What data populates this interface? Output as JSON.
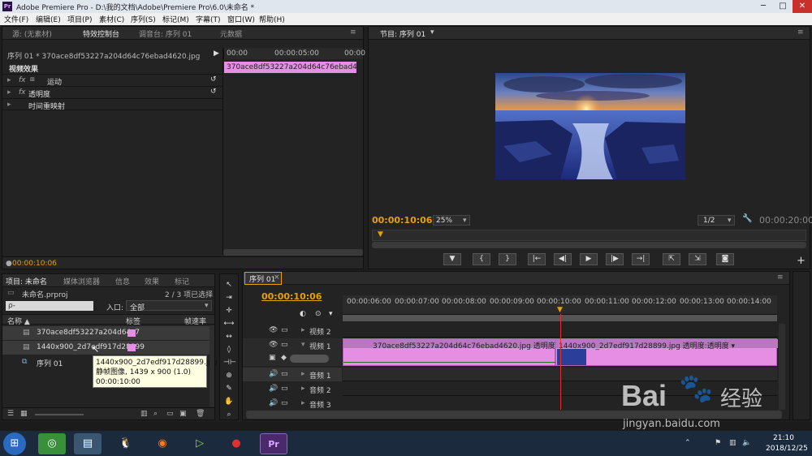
{
  "window": {
    "logo": "Pr",
    "title": "Adobe Premiere Pro - D:\\我的文档\\Adobe\\Premiere Pro\\6.0\\未命名 *",
    "controls": [
      "─",
      "□",
      "✕"
    ]
  },
  "menu": [
    "文件(F)",
    "编辑(E)",
    "项目(P)",
    "素材(C)",
    "序列(S)",
    "标记(M)",
    "字幕(T)",
    "窗口(W)",
    "帮助(H)"
  ],
  "effects_panel": {
    "tabs": [
      "源: (无素材)",
      "特效控制台",
      "调音台: 序列 01",
      "元数据"
    ],
    "menu_glyph": "≡",
    "clip_path": "序列 01 * 370ace8df53227a204d64c76ebad4620.jpg",
    "ruler": [
      "00:00",
      "00:00:05:00",
      "00:00"
    ],
    "clip_bar": "370ace8df53227a204d64c76ebad4620.jpg",
    "section": "视频效果",
    "fx_rows": [
      {
        "fx": "fx",
        "label": "运动",
        "reset": "↺"
      },
      {
        "fx": "fx",
        "label": "透明度",
        "reset": "↺"
      },
      {
        "fx": "",
        "label": "时间重映射",
        "reset": ""
      }
    ],
    "timecode": "00:00:10:06"
  },
  "program": {
    "tab": "节目: 序列 01",
    "timecode": "00:00:10:06",
    "zoom": "25%",
    "resolution": "1/2",
    "duration": "00:00:20:00",
    "buttons": [
      "▼",
      "{",
      "}",
      "|←",
      "◀|",
      "▶",
      "|▶",
      "→|",
      "⇱",
      "⇲",
      "◙"
    ]
  },
  "project": {
    "tabs": [
      "项目: 未命名",
      "媒体浏览器",
      "信息",
      "效果",
      "标记"
    ],
    "filename": "未命名.prproj",
    "count": "2 / 3 项已选择",
    "search_placeholder": "ρ-",
    "entry_label": "入口:",
    "entry_value": "全部",
    "col_name": "名称 ▲",
    "col_label": "标签",
    "col_rate": "帧速率",
    "items": [
      {
        "name": "370ace8df53227a204d64c7",
        "color": "#e58ee3"
      },
      {
        "name": "1440x900_2d7edf917d28899",
        "color": "#e58ee3"
      },
      {
        "name": "序列 01",
        "color": ""
      }
    ],
    "tooltip": [
      "1440x900_2d7edf917d28899.jpg",
      "静帧图像, 1439 x 900 (1.0)",
      "00:00:10:00"
    ]
  },
  "timeline": {
    "tab": "序列 01",
    "timecode": "00:00:10:06",
    "ruler": [
      "00:00:06:00",
      "00:00:07:00",
      "00:00:08:00",
      "00:00:09:00",
      "00:00:10:00",
      "00:00:11:00",
      "00:00:12:00",
      "00:00:13:00",
      "00:00:14:00"
    ],
    "tracks": [
      "视频 2",
      "视频 1",
      "音频 1",
      "音频 2",
      "音频 3"
    ],
    "clip1": "370ace8df53227a204d64c76ebad4620.jpg  透明度:透明度 ▾",
    "clip2": "1440x900_2d7edf917d28899.jpg  透明度:透明度 ▾"
  },
  "taskbar": {
    "time": "21:10",
    "date": "2018/12/25",
    "premiere": "Pr"
  },
  "watermark": {
    "brand": "Bai",
    "brand_cn": "经验",
    "url": "jingyan.baidu.com"
  }
}
